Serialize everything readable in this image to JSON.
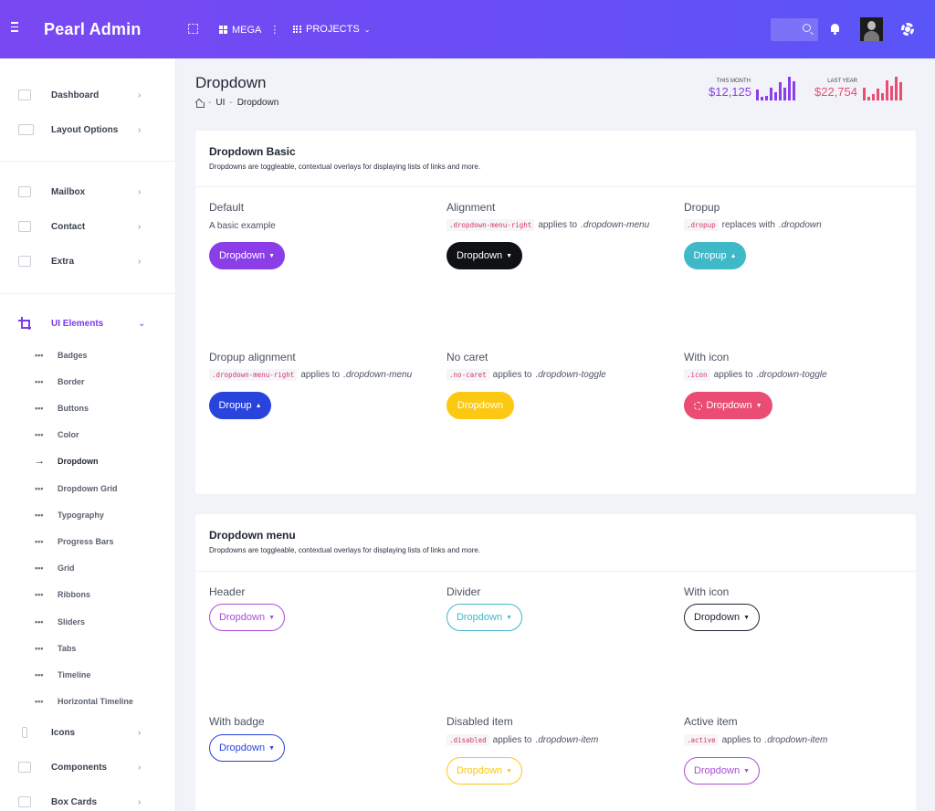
{
  "app": {
    "brand": "Pearl Admin"
  },
  "header": {
    "mega_label": "MEGA",
    "projects_label": "PROJECTS"
  },
  "sidebar": {
    "items": [
      {
        "label": "Dashboard",
        "icon": "monitor-icon"
      },
      {
        "label": "Layout Options",
        "icon": "screen-icon"
      },
      {
        "label": "Mailbox",
        "icon": "mail-icon"
      },
      {
        "label": "Contact",
        "icon": "contact-icon"
      },
      {
        "label": "Extra",
        "icon": "copy-icon"
      },
      {
        "label": "UI Elements",
        "icon": "crop-icon"
      },
      {
        "label": "Icons",
        "icon": "pin-icon"
      },
      {
        "label": "Components",
        "icon": "grid-icon"
      },
      {
        "label": "Box Cards",
        "icon": "box-icon"
      }
    ],
    "sub_items": [
      "Badges",
      "Border",
      "Buttons",
      "Color",
      "Dropdown",
      "Dropdown Grid",
      "Typography",
      "Progress Bars",
      "Grid",
      "Ribbons",
      "Sliders",
      "Tabs",
      "Timeline",
      "Horizontal Timeline"
    ],
    "active_sub": "Dropdown"
  },
  "page": {
    "title": "Dropdown",
    "breadcrumb": [
      "UI",
      "Dropdown"
    ]
  },
  "stats": [
    {
      "label": "THIS MONTH",
      "value": "$12,125",
      "color": "#8b3de8",
      "bars": [
        0.45,
        0.15,
        0.2,
        0.55,
        0.35,
        0.75,
        0.55,
        1.0,
        0.8
      ]
    },
    {
      "label": "LAST YEAR",
      "value": "$22,754",
      "color": "#ea4c73",
      "bars": [
        0.55,
        0.15,
        0.25,
        0.5,
        0.3,
        0.85,
        0.6,
        1.0,
        0.75
      ]
    }
  ],
  "card1": {
    "title": "Dropdown Basic",
    "subtitle": "Dropdowns are toggleable, contextual overlays for displaying lists of links and more.",
    "cells": [
      {
        "title": "Default",
        "desc": "A basic example",
        "button": "Dropdown"
      },
      {
        "title": "Alignment",
        "code": ".dropdown-menu-right",
        "desc_text": "applies to",
        "desc_em": ".dropdown-menu",
        "button": "Dropdown"
      },
      {
        "title": "Dropup",
        "code": ".dropup",
        "desc_text": "replaces with",
        "desc_em": ".dropdown",
        "button": "Dropup"
      },
      {
        "title": "Dropup alignment",
        "code": ".dropdown-menu-right",
        "desc_text": "applies to",
        "desc_em": ".dropdown-menu",
        "button": "Dropup"
      },
      {
        "title": "No caret",
        "code": ".no-caret",
        "desc_text": "applies to",
        "desc_em": ".dropdown-toggle",
        "button": "Dropdown"
      },
      {
        "title": "With icon",
        "code": ".icon",
        "desc_text": "applies to",
        "desc_em": ".dropdown-toggle",
        "button": "Dropdown"
      }
    ]
  },
  "card2": {
    "title": "Dropdown menu",
    "subtitle": "Dropdowns are toggleable, contextual overlays for displaying lists of links and more.",
    "cells": [
      {
        "title": "Header",
        "button": "Dropdown"
      },
      {
        "title": "Divider",
        "button": "Dropdown"
      },
      {
        "title": "With icon",
        "button": "Dropdown"
      },
      {
        "title": "With badge",
        "button": "Dropdown"
      },
      {
        "title": "Disabled item",
        "code": ".disabled",
        "desc_text": "applies to",
        "desc_em": ".dropdown-item",
        "button": "Dropdown"
      },
      {
        "title": "Active item",
        "code": ".active",
        "desc_text": "applies to",
        "desc_em": ".dropdown-item",
        "button": "Dropdown"
      }
    ]
  }
}
